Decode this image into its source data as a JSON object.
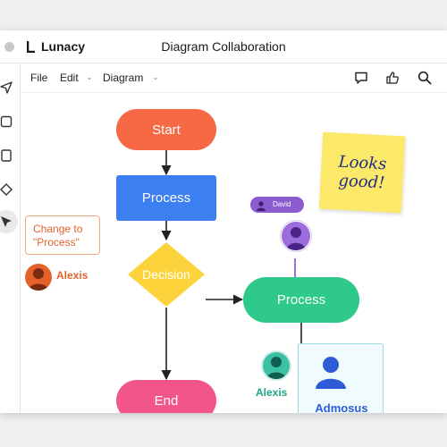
{
  "app": {
    "name": "Lunacy",
    "document_title": "Diagram Collaboration"
  },
  "menu": {
    "items": [
      {
        "label": "File",
        "has_dropdown": false
      },
      {
        "label": "Edit",
        "has_dropdown": true
      },
      {
        "label": "Diagram",
        "has_dropdown": true
      }
    ]
  },
  "toolbar_icons": [
    "comment-icon",
    "thumbs-up-icon",
    "search-icon"
  ],
  "sidebar_tools": [
    "navigation-arrow-icon",
    "square-icon",
    "document-icon",
    "diamond-icon",
    "pointer-icon"
  ],
  "diagram": {
    "nodes": {
      "start": "Start",
      "process1": "Process",
      "decision": "Decision",
      "process2": "Process",
      "end": "End"
    }
  },
  "sticky_note": {
    "text": "Looks\ngood!"
  },
  "comment": {
    "text": "Change to \"Process\"",
    "author": "Alexis"
  },
  "collaborators": {
    "david": {
      "name": "David"
    },
    "alexis": {
      "name": "Alexis"
    },
    "admosus": {
      "name": "Admosus"
    }
  },
  "colors": {
    "start": "#f76845",
    "process1": "#3b7ff1",
    "decision": "#fcd33a",
    "process2": "#2fc98b",
    "end": "#f2548c",
    "sticky": "#fce96a",
    "comment_accent": "#e4612a",
    "david": "#9b6dde",
    "alexis_teal": "#3ac1a6",
    "admosus": "#2f5bd6"
  }
}
